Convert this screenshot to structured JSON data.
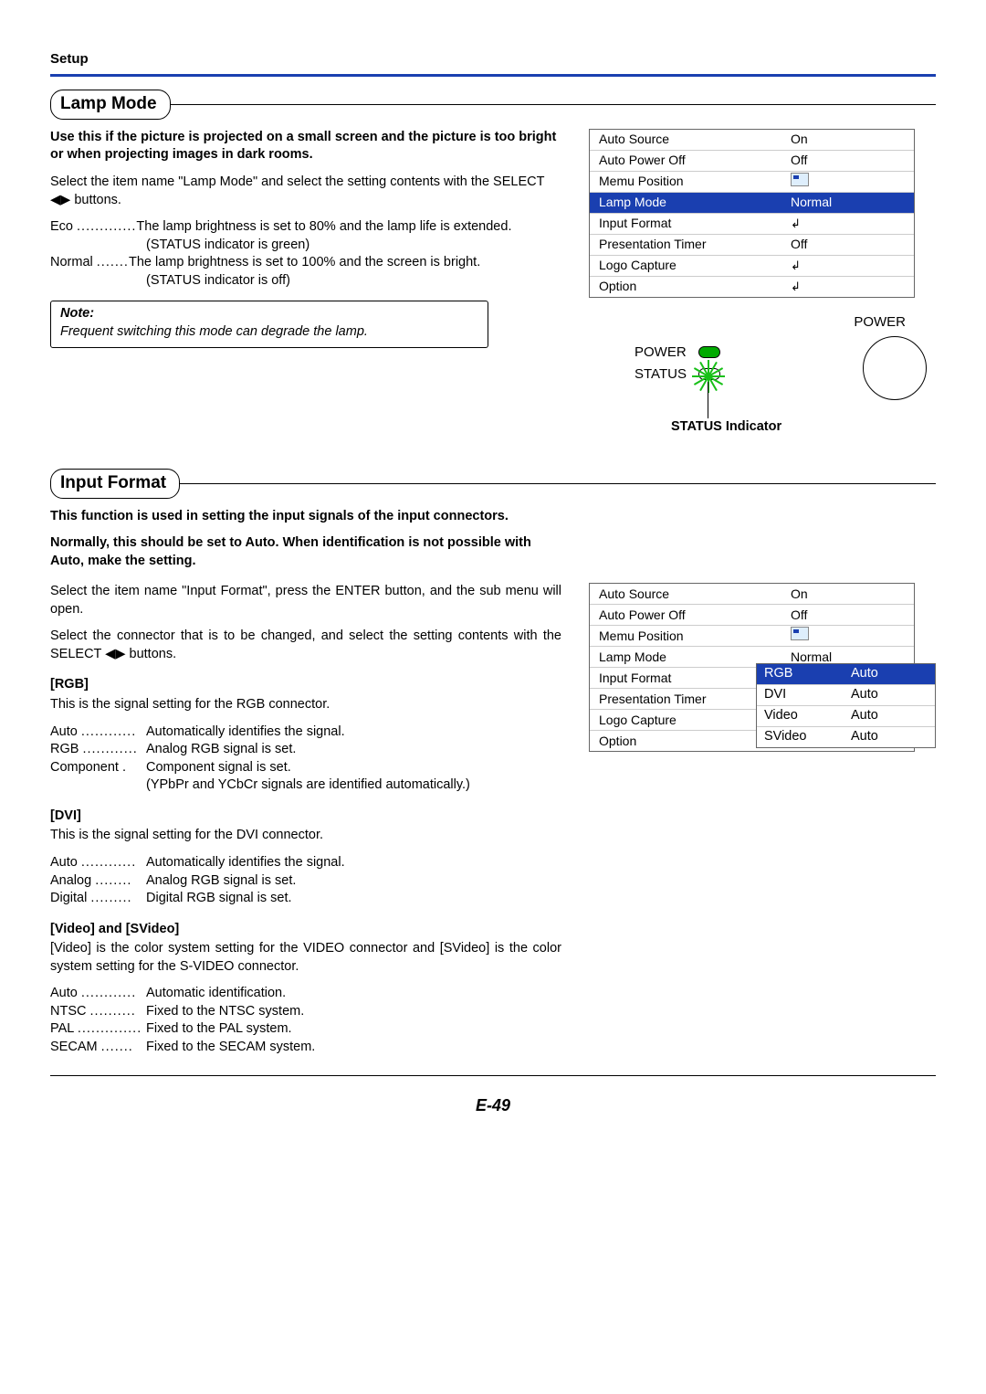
{
  "header": "Setup",
  "section1": {
    "title": "Lamp Mode",
    "intro": "Use this if the picture is projected on a small screen and the picture is too bright or when projecting images in dark rooms.",
    "desc": "Select the item name \"Lamp Mode\" and select the setting contents with the SELECT ◀▶ buttons.",
    "eco_term": "Eco",
    "eco_dots": ".............",
    "eco_body": "The lamp brightness is set to 80% and the lamp life is extended.",
    "eco_body2": "(STATUS indicator is green)",
    "normal_term": "Normal",
    "normal_dots": ".......",
    "normal_body": "The lamp brightness is set to 100% and the screen is bright.",
    "normal_body2": "(STATUS indicator is off)",
    "note_title": "Note:",
    "note_body": "Frequent switching this mode can degrade the lamp."
  },
  "menu1": {
    "rows": [
      {
        "label": "Auto Source",
        "value": "On"
      },
      {
        "label": "Auto Power Off",
        "value": "Off"
      },
      {
        "label": "Memu Position",
        "value": "[pos]"
      },
      {
        "label": "Lamp Mode",
        "value": "Normal",
        "selected": true
      },
      {
        "label": "Input Format",
        "value": "[enter]"
      },
      {
        "label": "Presentation Timer",
        "value": "Off"
      },
      {
        "label": "Logo Capture",
        "value": "[enter]"
      },
      {
        "label": "Option",
        "value": "[enter]"
      }
    ]
  },
  "indicator": {
    "power": "POWER",
    "power2": "POWER",
    "status": "STATUS",
    "caption": "STATUS Indicator"
  },
  "section2": {
    "title": "Input Format",
    "intro1": "This function is used in setting the input signals of the input connectors.",
    "intro2": "Normally, this should be set to Auto. When identification is not possible with Auto, make the setting.",
    "desc1": "Select the item name \"Input Format\", press the ENTER button, and the sub menu will open.",
    "desc2": "Select the connector that is to be changed, and select the setting contents with the SELECT ◀▶ buttons.",
    "rgb_hdr": "[RGB]",
    "rgb_desc": "This is the signal setting for the RGB connector.",
    "rgb_lines": [
      {
        "term": "Auto",
        "dots": "............",
        "body": "Automatically identifies the signal."
      },
      {
        "term": "RGB",
        "dots": "............",
        "body": "Analog RGB signal is set."
      },
      {
        "term": "Component .",
        "dots": "",
        "body": "Component signal is set."
      }
    ],
    "rgb_sub": "(YPbPr and YCbCr signals are identified automatically.)",
    "dvi_hdr": "[DVI]",
    "dvi_desc": "This is the signal setting for the DVI connector.",
    "dvi_lines": [
      {
        "term": "Auto",
        "dots": "............",
        "body": "Automatically identifies the signal."
      },
      {
        "term": "Analog",
        "dots": "........",
        "body": "Analog RGB signal is set."
      },
      {
        "term": "Digital",
        "dots": ".........",
        "body": "Digital RGB signal is set."
      }
    ],
    "vs_hdr": "[Video] and [SVideo]",
    "vs_desc": "[Video] is the color system setting for the VIDEO connector and [SVideo] is the color system setting for the S-VIDEO connector.",
    "vs_lines": [
      {
        "term": "Auto",
        "dots": "............",
        "body": "Automatic identification."
      },
      {
        "term": "NTSC",
        "dots": "..........",
        "body": "Fixed to the NTSC system."
      },
      {
        "term": "PAL",
        "dots": "..............",
        "body": "Fixed to the PAL system."
      },
      {
        "term": "SECAM",
        "dots": ".......",
        "body": "Fixed to the SECAM system."
      }
    ]
  },
  "menu2": {
    "rows": [
      {
        "label": "Auto Source",
        "value": "On"
      },
      {
        "label": "Auto Power Off",
        "value": "Off"
      },
      {
        "label": "Memu Position",
        "value": "[pos]"
      },
      {
        "label": "Lamp Mode",
        "value": "Normal"
      },
      {
        "label": "Input Format",
        "value": ""
      },
      {
        "label": "Presentation Timer",
        "value": ""
      },
      {
        "label": "Logo Capture",
        "value": ""
      },
      {
        "label": "Option",
        "value": ""
      }
    ],
    "sub": [
      {
        "label": "RGB",
        "value": "Auto",
        "selected": true
      },
      {
        "label": "DVI",
        "value": "Auto"
      },
      {
        "label": "Video",
        "value": "Auto"
      },
      {
        "label": "SVideo",
        "value": "Auto"
      }
    ]
  },
  "page_number": "E-49"
}
